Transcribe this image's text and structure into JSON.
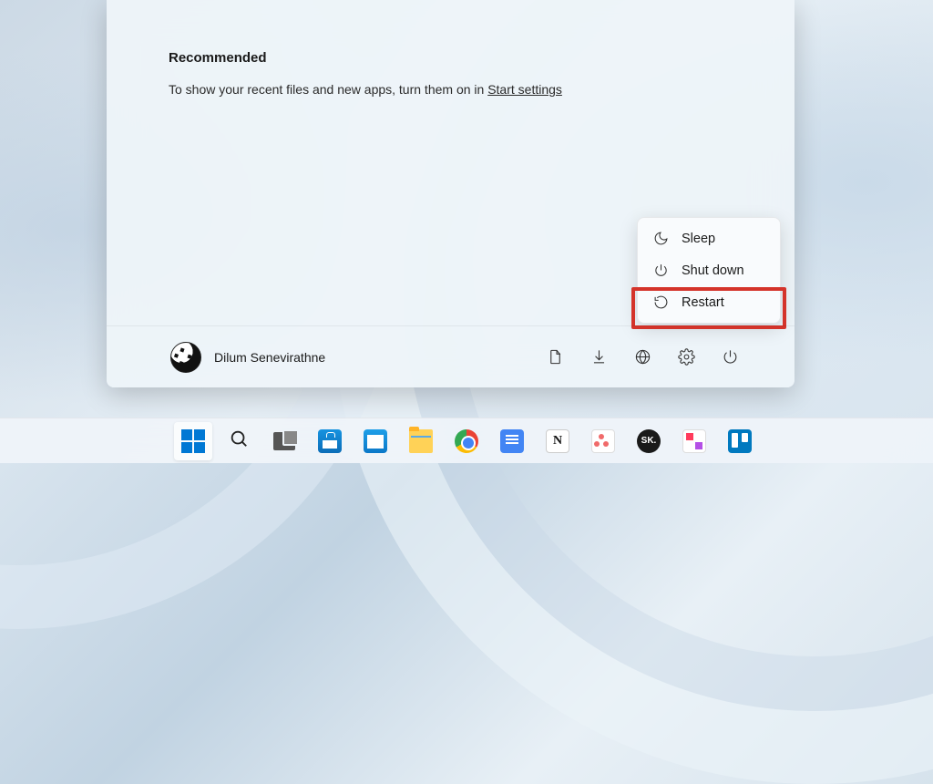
{
  "start": {
    "recommended_title": "Recommended",
    "recommended_text": "To show your recent files and new apps, turn them on in ",
    "recommended_link": "Start settings"
  },
  "user": {
    "name": "Dilum Senevirathne"
  },
  "footer_icons": {
    "doc": "document-icon",
    "download": "download-icon",
    "web": "web-icon",
    "settings": "settings-icon",
    "power": "power-icon"
  },
  "power_menu": {
    "sleep": "Sleep",
    "shutdown": "Shut down",
    "restart": "Restart"
  },
  "taskbar": {
    "items": [
      {
        "name": "start-button"
      },
      {
        "name": "search-button"
      },
      {
        "name": "task-view-button"
      },
      {
        "name": "microsoft-store"
      },
      {
        "name": "mail"
      },
      {
        "name": "file-explorer"
      },
      {
        "name": "google-chrome"
      },
      {
        "name": "google-docs"
      },
      {
        "name": "notion",
        "label": "N"
      },
      {
        "name": "asana"
      },
      {
        "name": "sk-app",
        "label": "SK."
      },
      {
        "name": "apple-music"
      },
      {
        "name": "trello"
      }
    ]
  }
}
